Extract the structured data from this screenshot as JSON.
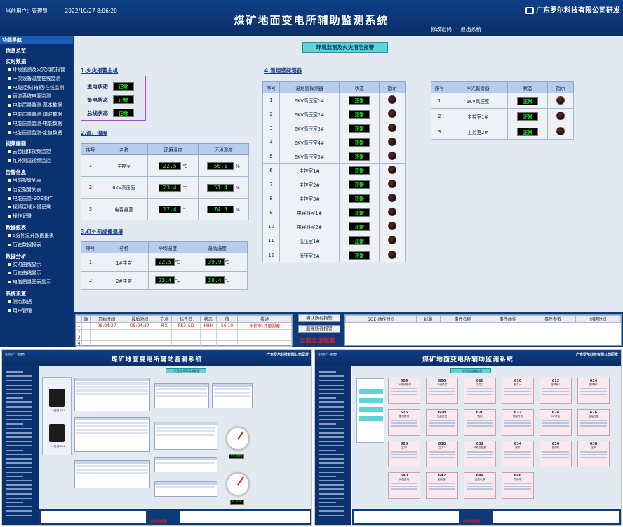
{
  "header": {
    "user_label": "当前用户：管理员",
    "datetime": "2022/10/27  8:06:20",
    "title": "煤矿地面变电所辅助监测系统",
    "brand": "广东罗尔科技有限公司研发",
    "change_password": "修改密码",
    "exit": "退出系统"
  },
  "sidebar": {
    "heading": "功能导航",
    "groups": [
      {
        "label": "信息总览",
        "items": []
      },
      {
        "label": "实时数据",
        "items": [
          "环境监测及火灾消防报警",
          "一次设备温度在线监测",
          "电缆接头(箱柜)在线监测",
          "直流系统电源监测",
          "电能质量监测-基本数据",
          "电能质量监测-谐波数据",
          "电能质量监测-电能数据",
          "电能质量监测-定值数据"
        ]
      },
      {
        "label": "视频画面",
        "items": [
          "云台固体视频监控",
          "红外测温视频监控"
        ]
      },
      {
        "label": "告警信息",
        "items": [
          "当前报警列表",
          "历史报警列表",
          "电能质量-SOE事件",
          "视频区域入侵记录",
          "操作记录"
        ]
      },
      {
        "label": "数据报表",
        "items": [
          "5分钟温升数据报表",
          "历史数据报表"
        ]
      },
      {
        "label": "数据分析",
        "items": [
          "实时曲线显示",
          "历史曲线显示",
          "电能质量图表显示"
        ]
      },
      {
        "label": "系统设置",
        "items": [
          "测点数据",
          "用户管理"
        ]
      }
    ]
  },
  "main": {
    "banner": "环境监测及火灾消防报警",
    "fire_host": {
      "heading": "1.火灾报警主机",
      "rows": [
        {
          "label": "主电状态",
          "status": "正常"
        },
        {
          "label": "备电状态",
          "status": "正常"
        },
        {
          "label": "总线状态",
          "status": "正常"
        }
      ]
    },
    "temp_humidity": {
      "heading": "2.温、湿度",
      "columns": [
        "序号",
        "名称",
        "环境温度",
        "环境湿度"
      ],
      "temp_unit": "℃",
      "hum_unit": "%",
      "rows": [
        {
          "no": "1",
          "name": "主控室",
          "temp": "22.5",
          "hum": "56.1"
        },
        {
          "no": "2",
          "name": "6KV高压室",
          "temp": "23.4",
          "hum": "51.4"
        },
        {
          "no": "3",
          "name": "电容器室",
          "temp": "17.4",
          "hum": "74.3"
        }
      ]
    },
    "ir_temp": {
      "heading": "3.红外热成像温度",
      "columns": [
        "序号",
        "名称",
        "平均温度",
        "最高温度"
      ],
      "unit": "℃",
      "rows": [
        {
          "no": "1",
          "name": "1#主变",
          "avg": "22.5",
          "max": "39.9"
        },
        {
          "no": "2",
          "name": "2#主变",
          "avg": "23.4",
          "max": "38.4"
        }
      ]
    },
    "smoke": {
      "heading": "4.温烟感探测器",
      "columns": [
        "序号",
        "温烟感探测器",
        "状态",
        "指示"
      ],
      "rows": [
        {
          "no": "1",
          "name": "6KV高压室1#",
          "status": "正常"
        },
        {
          "no": "2",
          "name": "6KV高压室2#",
          "status": "正常"
        },
        {
          "no": "3",
          "name": "6KV高压室3#",
          "status": "正常"
        },
        {
          "no": "4",
          "name": "6KV高压室4#",
          "status": "正常"
        },
        {
          "no": "5",
          "name": "6KV高压室5#",
          "status": "正常"
        },
        {
          "no": "6",
          "name": "主控室1#",
          "status": "正常"
        },
        {
          "no": "7",
          "name": "主控室2#",
          "status": "正常"
        },
        {
          "no": "8",
          "name": "主控室3#",
          "status": "正常"
        },
        {
          "no": "9",
          "name": "电容器室1#",
          "status": "正常"
        },
        {
          "no": "10",
          "name": "电容器室2#",
          "status": "正常"
        },
        {
          "no": "11",
          "name": "低压室1#",
          "status": "正常"
        },
        {
          "no": "12",
          "name": "低压室2#",
          "status": "正常"
        }
      ]
    },
    "sound": {
      "columns": [
        "序号",
        "声光报警器",
        "状态",
        "指示"
      ],
      "rows": [
        {
          "no": "1",
          "name": "6KV高压室",
          "status": "正常"
        },
        {
          "no": "2",
          "name": "主控室1#",
          "status": "正常"
        },
        {
          "no": "3",
          "name": "主控室2#",
          "status": "正常"
        }
      ]
    }
  },
  "bottom": {
    "alarm_columns": [
      "确",
      "开始时间",
      "最后时间",
      "节点",
      "标签名",
      "状态",
      "值",
      "描述"
    ],
    "alarm_rows": [
      {
        "no": "1",
        "ack": "",
        "start": "08:04:37",
        "last": "08:04:37",
        "node": "PIX",
        "tag": "PK3_SD",
        "state": "HIHI",
        "value": "56.10",
        "desc": "主控室-环境湿度"
      },
      {
        "no": "2"
      },
      {
        "no": "3"
      },
      {
        "no": "4"
      }
    ],
    "btn_ack_all": "确认所有报警",
    "btn_delete_all": "删除所有报警",
    "all_alarms": "当前全部报警",
    "soe_columns": [
      "SOE-动作时间",
      "线路",
      "事件名称",
      "事件动作",
      "事件参数",
      "创建时间"
    ]
  },
  "thumb1": {
    "title": "煤矿地面变电所辅助监测系统",
    "brand": "广东罗尔科技有限公司研发",
    "banner": "1#进线-601基本数据",
    "device1": "1#进线-601",
    "device2": "2#进线-604",
    "gauge1": "49.998",
    "gauge2": "0.836",
    "btn": "当前全部报警"
  },
  "thumb2": {
    "title": "煤矿地面变电所辅助监测系统",
    "brand": "广东罗尔科技有限公司研发",
    "banner": "一次设备温度监测",
    "btn": "当前全部报警",
    "cards": [
      {
        "code": "604",
        "name": "2#进线电源"
      },
      {
        "code": "606",
        "name": "中央风井"
      },
      {
        "code": "608",
        "name": "主井二"
      },
      {
        "code": "610",
        "name": "副井一"
      },
      {
        "code": "612",
        "name": "压风房2"
      },
      {
        "code": "614",
        "name": "压风房2"
      },
      {
        "code": "616",
        "name": "备用备用"
      },
      {
        "code": "618",
        "name": "至高压室"
      },
      {
        "code": "620",
        "name": "备用"
      },
      {
        "code": "622",
        "name": "联络开关"
      },
      {
        "code": "624",
        "name": "1#所变"
      },
      {
        "code": "626",
        "name": "至高压室"
      },
      {
        "code": "628",
        "name": "主井1"
      },
      {
        "code": "630",
        "name": "主井2"
      },
      {
        "code": "632",
        "name": "风机变压器"
      },
      {
        "code": "634",
        "name": "副井"
      },
      {
        "code": "636",
        "name": "压风机"
      },
      {
        "code": "638",
        "name": "压风"
      },
      {
        "code": "640",
        "name": "风机备用"
      },
      {
        "code": "642",
        "name": "电容器2"
      },
      {
        "code": "644",
        "name": "进线电源"
      },
      {
        "code": "646",
        "name": "所用电"
      }
    ]
  }
}
